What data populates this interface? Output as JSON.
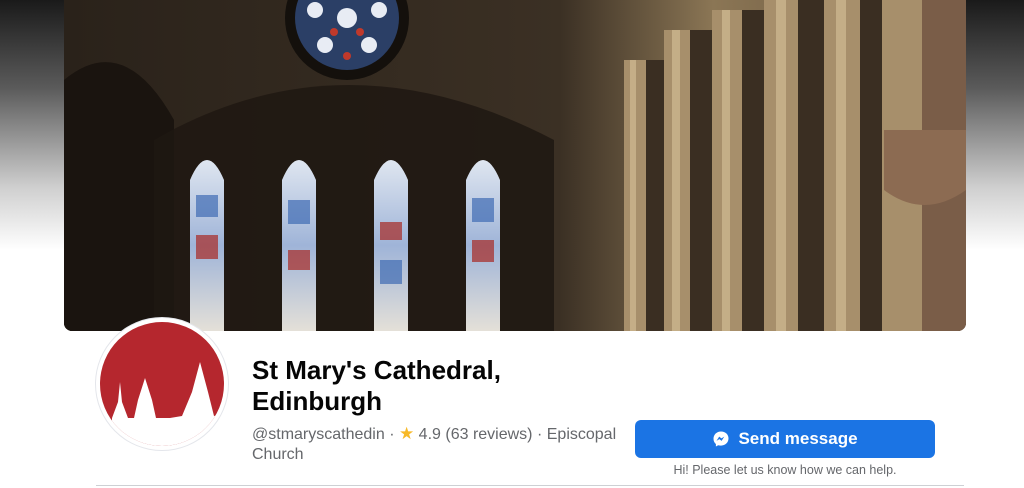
{
  "page": {
    "title": "St Mary's Cathedral, Edinburgh",
    "handle": "@stmaryscathedin",
    "separator": "·",
    "rating_icon": "star-icon",
    "rating": "4.9",
    "reviews": "(63 reviews)",
    "category": "Episcopal Church"
  },
  "actions": {
    "send_message_label": "Send message",
    "send_message_icon": "messenger-icon",
    "help_text": "Hi! Please let us know how we can help."
  },
  "cover": {
    "image_subject": "cathedral-interior-stained-glass"
  },
  "colors": {
    "primary_button": "#1b74e4",
    "avatar_red": "#b5272e",
    "star": "#f7b928",
    "secondary_text": "#65676b"
  }
}
